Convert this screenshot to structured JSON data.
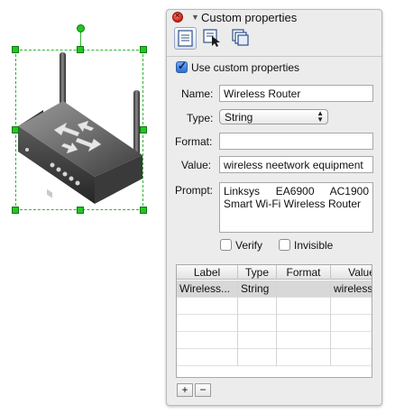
{
  "panel": {
    "title": "Custom properties",
    "toolbar": {
      "tabs": [
        "properties-tab",
        "select-tab",
        "layers-tab"
      ]
    }
  },
  "form": {
    "use_custom_label": "Use custom properties",
    "use_custom_checked": true,
    "name_label": "Name:",
    "name_value": "Wireless Router",
    "type_label": "Type:",
    "type_value": "String",
    "format_label": "Format:",
    "format_value": "",
    "value_label": "Value:",
    "value_value": "wireless neetwork equipment",
    "prompt_label": "Prompt:",
    "prompt_value": "Linksys EA6900 AC1900 Smart Wi-Fi Wireless Router",
    "verify_label": "Verify",
    "verify_checked": false,
    "invisible_label": "Invisible",
    "invisible_checked": false
  },
  "table": {
    "columns": [
      "Label",
      "Type",
      "Format",
      "Value"
    ],
    "rows": [
      [
        "Wireless...",
        "String",
        "",
        "wireless"
      ]
    ]
  },
  "buttons": {
    "add": "+",
    "remove": "−"
  }
}
